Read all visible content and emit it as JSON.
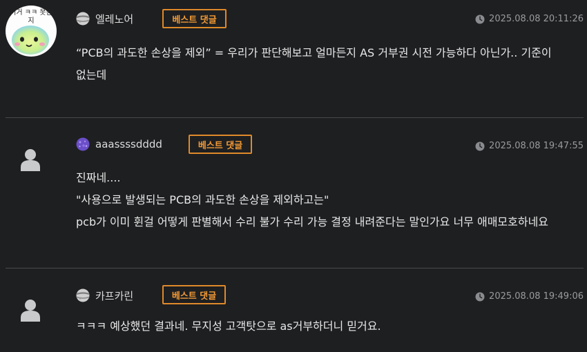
{
  "comments": [
    {
      "nickname": "엘레노어",
      "badge": "베스트 댓글",
      "date": "2025.08.08 20:11:26",
      "avatar_text": "이거 ㅋㅋ 못참지",
      "lines": [
        "“PCB의 과도한 손상을 제외” = 우리가 판단해보고 얼마든지 AS 거부권 시전 가능하다 아닌가.. 기준이",
        "없는데"
      ]
    },
    {
      "nickname": "aaassssdddd",
      "badge": "베스트 댓글",
      "date": "2025.08.08 19:47:55",
      "lines": [
        "진짜네....",
        "\"사용으로 발생되는 PCB의 과도한 손상을 제외하고는\"",
        "pcb가 이미 휜걸 어떻게 판별해서 수리 불가 수리 가능 결정 내려준다는 말인가요 너무 애매모호하네요"
      ]
    },
    {
      "nickname": "카프카린",
      "badge": "베스트 댓글",
      "date": "2025.08.08 19:49:06",
      "lines": [
        "ㅋㅋㅋ 예상했던 결과네. 무지성 고객탓으로 as거부하더니 믿거요."
      ]
    }
  ],
  "colors": {
    "background": "#1e1f21",
    "badge_border": "#e08a2a",
    "badge_text": "#f29a36",
    "divider": "#4a4b4e",
    "date_text": "#9a9b9e"
  },
  "icons": {
    "clock": "clock-icon",
    "default_avatar": "person-silhouette-icon",
    "tier_grey": "grey-planet-icon",
    "tier_purple": "purple-planet-icon"
  }
}
